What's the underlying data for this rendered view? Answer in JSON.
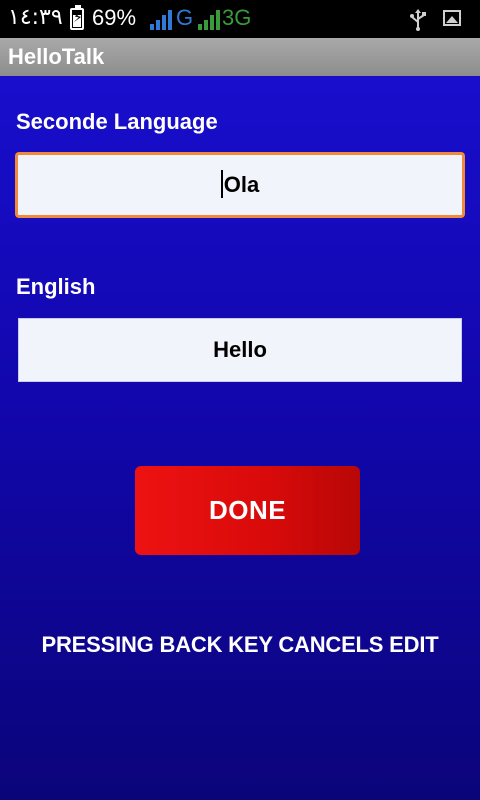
{
  "status_bar": {
    "time": "١٤:٣٩",
    "battery_percent": "69%",
    "network_1": "G",
    "network_2": "3G",
    "colors": {
      "network_1": "#2f7ad6",
      "network_2": "#3a9b3a"
    },
    "icons": [
      "battery-charging-icon",
      "signal-icon",
      "usb-icon",
      "image-notification-icon"
    ]
  },
  "app": {
    "title": "HelloTalk"
  },
  "form": {
    "second_language_label": "Seconde Language",
    "second_language_value": "Ola",
    "english_label": "English",
    "english_value": "Hello",
    "done_label": "DONE",
    "hint": "PRESSING BACK KEY CANCELS EDIT"
  },
  "colors": {
    "background": "#1a10d4",
    "done_button": "#e00e0e",
    "focus_border": "#ee8a3a"
  }
}
